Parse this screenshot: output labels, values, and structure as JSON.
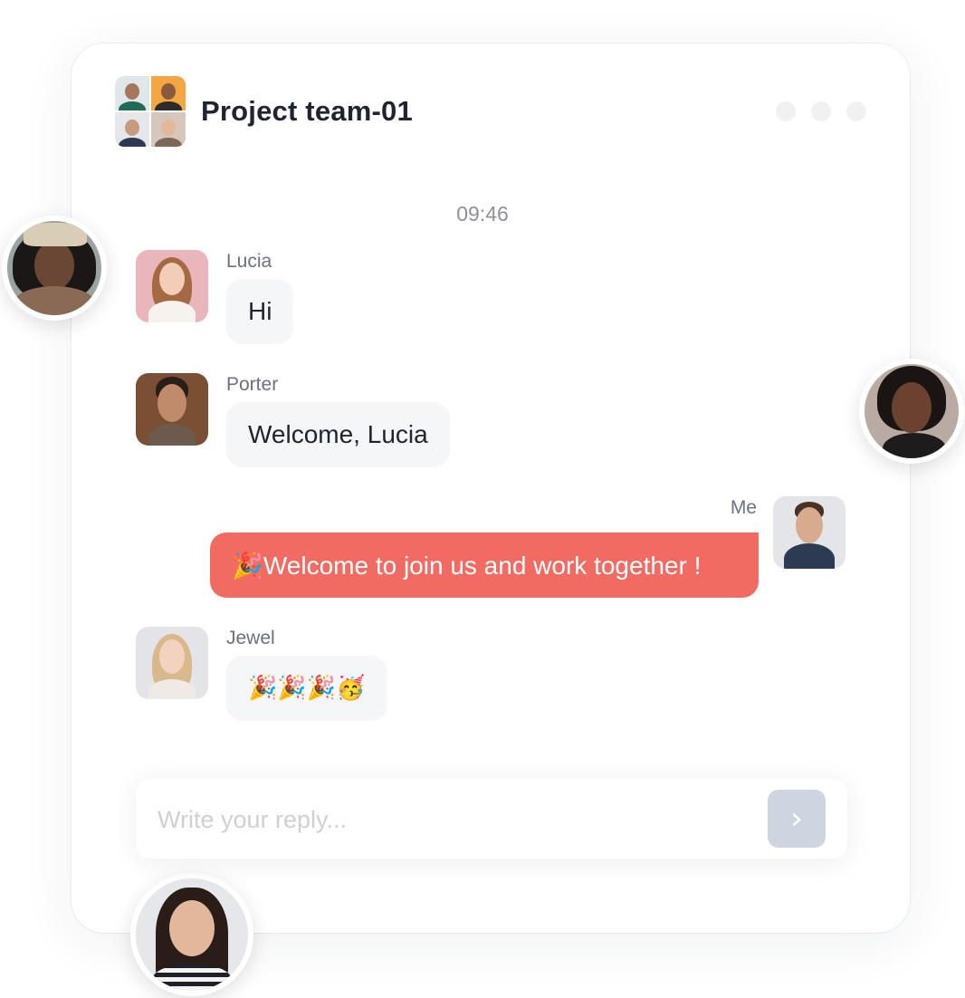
{
  "header": {
    "title": "Project team-01"
  },
  "timestamp": "09:46",
  "messages": [
    {
      "sender": "Lucia",
      "text": "Hi"
    },
    {
      "sender": "Porter",
      "text": "Welcome, Lucia"
    },
    {
      "sender": "Me",
      "text": "🎉Welcome to join us and work together !"
    },
    {
      "sender": "Jewel",
      "text": "🎉🎉🎉🥳"
    }
  ],
  "composer": {
    "placeholder": "Write your reply...",
    "send_icon": "chevron-right-icon"
  },
  "colors": {
    "accent": "#f26b62",
    "bubble": "#f5f6f8",
    "send_button": "#cfd4e1"
  }
}
